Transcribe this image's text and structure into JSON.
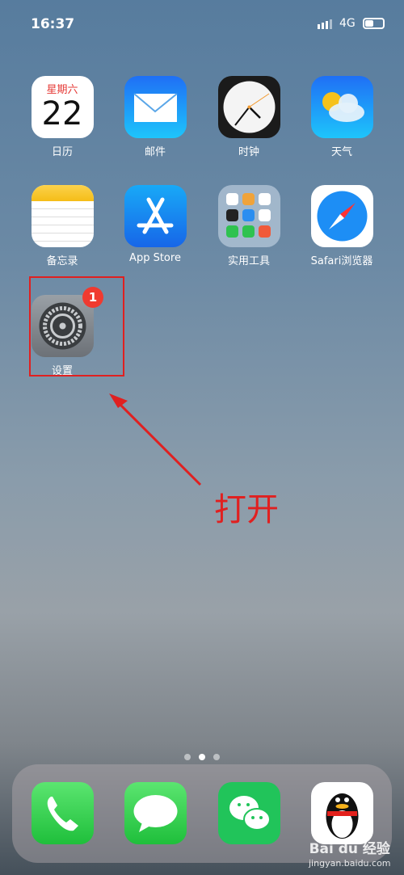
{
  "status": {
    "time": "16:37",
    "network": "4G",
    "battery_level": 0.4
  },
  "apps": [
    {
      "label": "日历",
      "icon": "calendar-icon",
      "weekday": "星期六",
      "day": "22"
    },
    {
      "label": "邮件",
      "icon": "mail-icon"
    },
    {
      "label": "时钟",
      "icon": "clock-icon"
    },
    {
      "label": "天气",
      "icon": "weather-icon"
    },
    {
      "label": "备忘录",
      "icon": "notes-icon"
    },
    {
      "label": "App Store",
      "icon": "app-store-icon"
    },
    {
      "label": "实用工具",
      "icon": "folder-icon"
    },
    {
      "label": "Safari浏览器",
      "icon": "safari-icon"
    },
    {
      "label": "设置",
      "icon": "settings-icon",
      "badge": "1"
    }
  ],
  "annotation": {
    "text": "打开",
    "color": "#e02020"
  },
  "page_dots": {
    "count": 3,
    "active": 1
  },
  "dock": [
    {
      "icon": "phone-icon"
    },
    {
      "icon": "messages-icon"
    },
    {
      "icon": "wechat-icon"
    },
    {
      "icon": "qq-icon"
    }
  ],
  "watermark": {
    "brand": "Bai du 经验",
    "url": "jingyan.baidu.com"
  }
}
